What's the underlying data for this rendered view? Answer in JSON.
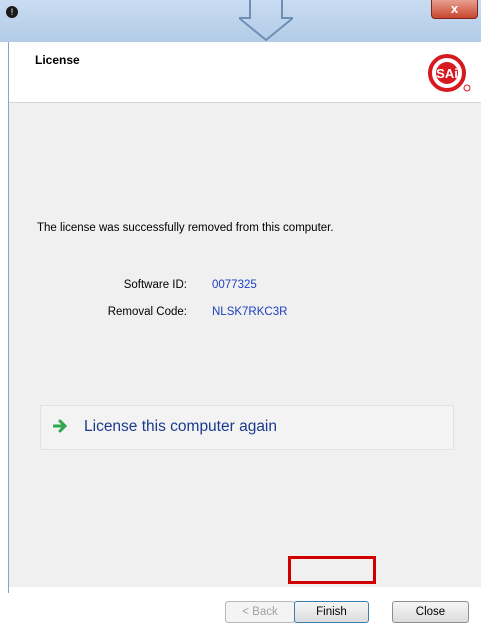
{
  "window": {
    "close_glyph": "x",
    "app_icon_glyph": "!"
  },
  "header": {
    "title": "License",
    "logo_text": "SAi",
    "logo_color": "#d71920"
  },
  "content": {
    "message": "The license was successfully removed from this computer.",
    "fields": {
      "software_id_label": "Software ID:",
      "software_id_value": "0077325",
      "removal_code_label": "Removal Code:",
      "removal_code_value": "NLSK7RKC3R"
    },
    "action_link": "License this computer again",
    "action_icon": "green-arrow-icon"
  },
  "footer": {
    "back_label": "< Back",
    "back_enabled": false,
    "finish_label": "Finish",
    "close_label": "Close"
  },
  "colors": {
    "value_text": "#1f3fbf",
    "link_text": "#1a3a8c",
    "highlight": "#d00000"
  }
}
